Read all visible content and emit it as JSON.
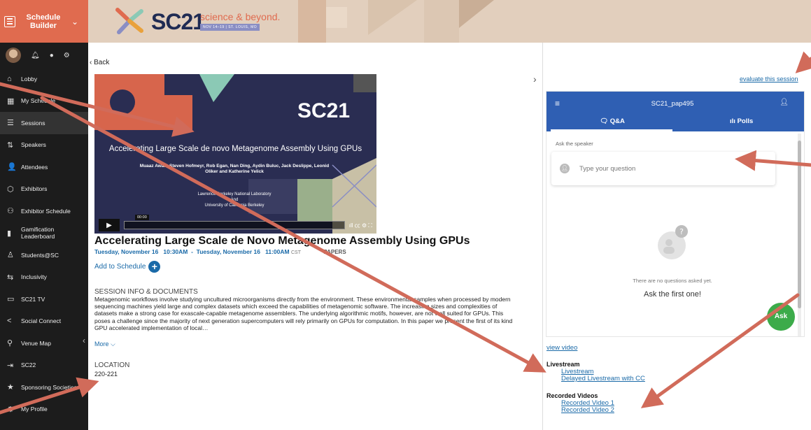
{
  "sidebar": {
    "title": "Schedule Builder",
    "items": [
      {
        "label": "Lobby",
        "icon": "home-icon",
        "glyph": "⌂"
      },
      {
        "label": "My Schedule",
        "icon": "calendar-icon",
        "glyph": "▦"
      },
      {
        "label": "Sessions",
        "icon": "list-icon",
        "glyph": "☰"
      },
      {
        "label": "Speakers",
        "icon": "sort-az-icon",
        "glyph": "⇅"
      },
      {
        "label": "Attendees",
        "icon": "person-icon",
        "glyph": "👤"
      },
      {
        "label": "Exhibitors",
        "icon": "cube-icon",
        "glyph": "⬡"
      },
      {
        "label": "Exhibitor Schedule",
        "icon": "users-icon",
        "glyph": "⚇"
      },
      {
        "label": "Gamification Leaderboard",
        "icon": "bookmark-icon",
        "glyph": "▮"
      },
      {
        "label": "Students@SC",
        "icon": "student-icon",
        "glyph": "♙"
      },
      {
        "label": "Inclusivity",
        "icon": "handshake-icon",
        "glyph": "⇆"
      },
      {
        "label": "SC21 TV",
        "icon": "tv-icon",
        "glyph": "▭"
      },
      {
        "label": "Social Connect",
        "icon": "share-icon",
        "glyph": "<"
      },
      {
        "label": "Venue Map",
        "icon": "map-pin-icon",
        "glyph": "⚲"
      },
      {
        "label": "SC22",
        "icon": "sign-in-icon",
        "glyph": "⇥"
      },
      {
        "label": "Sponsoring Societies",
        "icon": "star-icon",
        "glyph": "★"
      },
      {
        "label": "My Profile",
        "icon": "gear-icon",
        "glyph": "⚙"
      }
    ]
  },
  "banner": {
    "logo": "SC21",
    "tagline": "science & beyond.",
    "dates": "NOV 14–19 | ST. LOUIS, MO"
  },
  "main": {
    "back": "Back",
    "video": {
      "logo": "SC21",
      "title": "Accelerating Large Scale de novo Metagenome Assembly Using GPUs",
      "authors": "Muaaz Awan, Steven Hofmeyr, Rob Egan, Nan Ding, Aydin Buluc, Jack Deslippe, Leonid Oliker and Katherine Yelick",
      "institution": "Lawrence Berkeley National Laboratory\nAnd\nUniversity of California Berkeley",
      "time": "00:00"
    },
    "session_title": "Accelerating Large Scale de Novo Metagenome Assembly Using GPUs",
    "time_start": "Tuesday, November 16   10:30AM",
    "time_sep": "  -  ",
    "time_end": "Tuesday, November 16   11:00AM",
    "timezone": "CST",
    "category": "PAPERS",
    "add_to_schedule": "Add to Schedule",
    "info_heading": "SESSION INFO & DOCUMENTS",
    "info_body": "Metagenomic workflows involve studying uncultured microorganisms directly from the environment. These environmental samples when processed by modern sequencing machines yield large and complex datasets which exceed the capabilities of metagenomic software. The increasing sizes and complexities of datasets make a strong case for exascale-capable metagenome assemblers. The underlying algorithmic motifs, however, are not well suited for GPUs. This poses a challenge since the majority of next generation supercomputers will rely primarily on GPUs for computation. In this paper we present the first of its kind GPU accelerated implementation of local…",
    "more": "More",
    "location_heading": "LOCATION",
    "location": "220-221"
  },
  "right": {
    "evaluate": "evaluate this session",
    "qa": {
      "session_id": "SC21_pap495",
      "tab_qa": "Q&A",
      "tab_polls": "Polls",
      "ask_label": "Ask the speaker",
      "placeholder": "Type your question",
      "empty_1": "There are no questions asked yet.",
      "empty_2": "Ask the first one!",
      "ask_button": "Ask"
    },
    "view_video": "view video",
    "livestream_heading": "Livestream",
    "livestream_links": [
      "Livestream",
      "Delayed Livestream with CC"
    ],
    "recorded_heading": "Recorded Videos",
    "recorded_links": [
      "Recorded Video 1",
      "Recorded Video 2"
    ]
  },
  "colors": {
    "sidebar_bg": "#1c1c1c",
    "brand_coral": "#e06b4f",
    "link_blue": "#1a6aa8",
    "qa_blue": "#2f5fb3",
    "ask_green": "#3cab4a",
    "arrow": "#d16b5a"
  }
}
